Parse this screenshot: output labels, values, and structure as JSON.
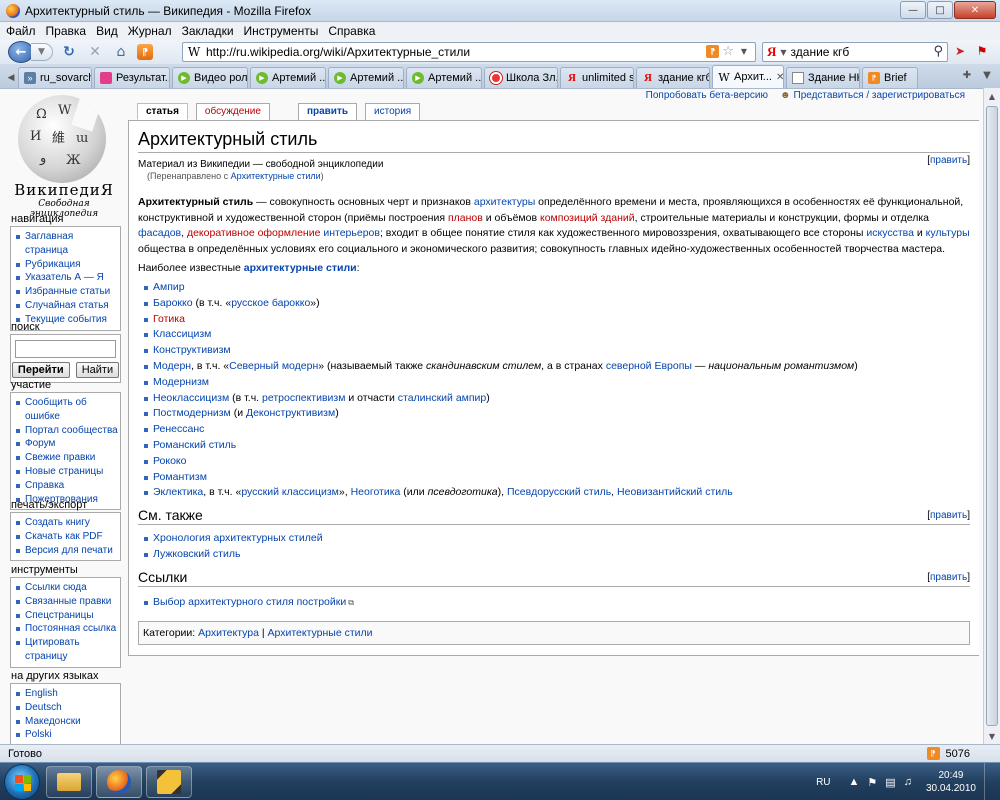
{
  "window": {
    "title": "Архитектурный стиль — Википедия - Mozilla Firefox",
    "controls": {
      "minimize": "—",
      "maximize": "□",
      "close": "✕"
    }
  },
  "menu": [
    "Файл",
    "Правка",
    "Вид",
    "Журнал",
    "Закладки",
    "Инструменты",
    "Справка"
  ],
  "nav": {
    "url": "http://ru.wikipedia.org/wiki/Архитектурные_стили",
    "search_value": "здание кгб",
    "search_engine_letter": "Я"
  },
  "tabs": [
    {
      "label": "ru_sovarch...",
      "icon": "vk"
    },
    {
      "label": "Результат...",
      "icon": "doc"
    },
    {
      "label": "Видео рол...",
      "icon": "play"
    },
    {
      "label": "Артемий ...",
      "icon": "play"
    },
    {
      "label": "Артемий ...",
      "icon": "play"
    },
    {
      "label": "Артемий ...",
      "icon": "play"
    },
    {
      "label": "Школа Зл...",
      "icon": "yt"
    },
    {
      "label": "unlimited s...",
      "icon": "ya"
    },
    {
      "label": "здание кгб...",
      "icon": "ya"
    },
    {
      "label": "Архит...",
      "icon": "w",
      "active": true
    },
    {
      "label": "Здание НК...",
      "icon": "page"
    },
    {
      "label": "Brief",
      "icon": "rss2"
    }
  ],
  "wiki": {
    "logo_title": "ВикипедиЯ",
    "logo_subtitle": "Свободная энциклопедия",
    "personal": {
      "beta": "Попробовать бета-версию",
      "login": "Представиться / зарегистрироваться"
    },
    "content_tabs": {
      "article": "статья",
      "discussion": "обсуждение",
      "edit": "править",
      "history": "история"
    },
    "navigation": {
      "heading": "навигация",
      "items": [
        "Заглавная страница",
        "Рубрикация",
        "Указатель А — Я",
        "Избранные статьи",
        "Случайная статья",
        "Текущие события"
      ]
    },
    "search": {
      "heading": "поиск",
      "go": "Перейти",
      "find": "Найти"
    },
    "participation": {
      "heading": "участие",
      "items": [
        "Сообщить об ошибке",
        "Портал сообщества",
        "Форум",
        "Свежие правки",
        "Новые страницы",
        "Справка",
        "Пожертвования"
      ]
    },
    "print": {
      "heading": "печать/экспорт",
      "items": [
        "Создать книгу",
        "Скачать как PDF",
        "Версия для печати"
      ]
    },
    "tools": {
      "heading": "инструменты",
      "items": [
        "Ссылки сюда",
        "Связанные правки",
        "Спецстраницы",
        "Постоянная ссылка",
        "Цитировать страницу"
      ]
    },
    "languages": {
      "heading": "на других языках",
      "items": [
        "English",
        "Deutsch",
        "Македонски",
        "Polski"
      ]
    },
    "article": {
      "title": "Архитектурный стиль",
      "site_sub": "Материал из Википедии — свободной энциклопедии",
      "redirect_prefix": "(Перенаправлено с ",
      "redirect_link": "Архитектурные стили",
      "redirect_suffix": ")",
      "edit_link": "править",
      "lead": {
        "term": "Архитектурный стиль",
        "t1": " — совокупность основных черт и признаков ",
        "l1": "архитектуры",
        "t2": " определённого времени и места, проявляющихся в особенностях её функциональной, конструктивной и художественной сторон (приёмы построения ",
        "l2": "планов",
        "t3": " и объёмов ",
        "l3": "композиций зданий",
        "t4": ", строительные материалы и конструкции, формы и отделка ",
        "l4": "фасадов",
        "t5": ", ",
        "l5": "декоративное оформление",
        "t6": " ",
        "l6": "интерьеров",
        "t7": "; входит в общее понятие стиля как художественного мировоззрения, охватывающего все стороны ",
        "l7": "искусства",
        "t8": " и ",
        "l8": "культуры",
        "t9": " общества в определённых условиях его социального и экономического развития; совокупность главных идейно-художественных особенностей творчества мастера."
      },
      "known_prefix": "Наиболее известные ",
      "known_link": "архитектурные стили",
      "known_suffix": ":",
      "styles": {
        "ampir": "Ампир",
        "baroque": "Барокко",
        "baroque_t": " (в т.ч. «",
        "baroque_l": "русское барокко",
        "baroque_e": "»)",
        "gothic": "Готика",
        "classicism": "Классицизм",
        "constructivism": "Конструктивизм",
        "modern": "Модерн",
        "modern_t1": ", в т.ч. «",
        "modern_l1": "Северный модерн",
        "modern_t2": "» (называемый также ",
        "modern_i1": "скандинавским стилем",
        "modern_t3": ", а в странах ",
        "modern_l2": "северной Европы",
        "modern_t4": " — ",
        "modern_i2": "национальным романтизмом",
        "modern_t5": ")",
        "modernism": "Модернизм",
        "neoclassicism": "Неоклассицизм",
        "neoclassicism_t1": " (в т.ч. ",
        "neoclassicism_l1": "ретроспективизм",
        "neoclassicism_t2": " и отчасти ",
        "neoclassicism_l2": "сталинский ампир",
        "neoclassicism_t3": ")",
        "postmodernism": "Постмодернизм",
        "postmodernism_t1": " (и ",
        "postmodernism_l1": "Деконструктивизм",
        "postmodernism_t2": ")",
        "renaissance": "Ренессанс",
        "romanesque": "Романский стиль",
        "rococo": "Рококо",
        "romanticism": "Романтизм",
        "eclectic": "Эклектика",
        "eclectic_t1": ", в т.ч. «",
        "eclectic_l1": "русский классицизм",
        "eclectic_t2": "», ",
        "eclectic_l2": "Неоготика",
        "eclectic_t3": " (или ",
        "eclectic_i1": "псевдоготика",
        "eclectic_t4": "), ",
        "eclectic_l3": "Псевдорусский стиль",
        "eclectic_t5": ", ",
        "eclectic_l4": "Неовизантийский стиль"
      },
      "see_also": {
        "heading": "См. также",
        "items": [
          "Хронология архитектурных стилей",
          "Лужковский стиль"
        ]
      },
      "links": {
        "heading": "Ссылки",
        "items": [
          "Выбор архитектурного стиля постройки"
        ]
      },
      "categories": {
        "prefix": "Категории: ",
        "items": [
          "Архитектура",
          "Архитектурные стили"
        ],
        "separator": " | "
      }
    }
  },
  "status": {
    "text": "Готово",
    "rss_count": "5076"
  },
  "taskbar": {
    "lang": "RU",
    "time": "20:49",
    "date": "30.04.2010"
  }
}
